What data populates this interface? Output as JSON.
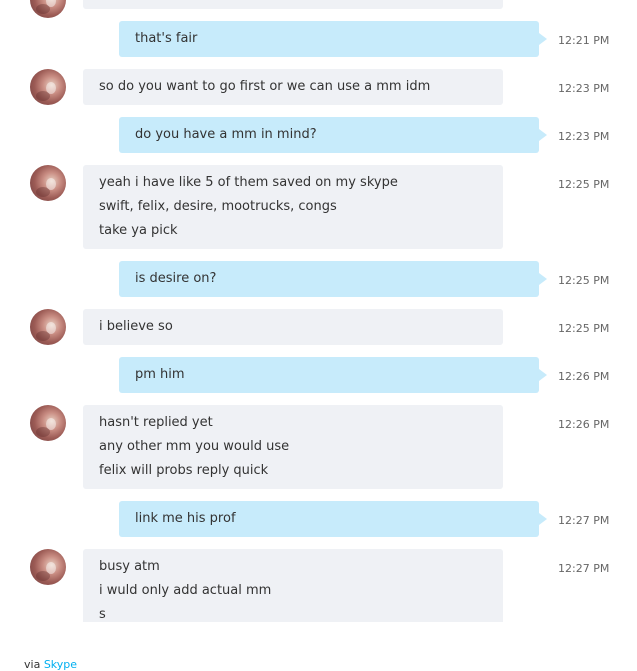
{
  "colors": {
    "incoming_bubble": "#eff1f5",
    "outgoing_bubble": "#c7ebfb",
    "link": "#00aff0",
    "timestamp": "#666666"
  },
  "messages": [
    {
      "direction": "incoming",
      "lines": [],
      "time": ""
    },
    {
      "direction": "outgoing",
      "lines": [
        "that's fair"
      ],
      "time": "12:21 PM"
    },
    {
      "direction": "incoming",
      "lines": [
        "so do you want to go first or we can use a mm idm"
      ],
      "time": "12:23 PM"
    },
    {
      "direction": "outgoing",
      "lines": [
        "do you have a mm in mind?"
      ],
      "time": "12:23 PM"
    },
    {
      "direction": "incoming",
      "lines": [
        "yeah i have like 5 of them saved on my skype",
        "swift, felix, desire, mootrucks, congs",
        "take ya pick"
      ],
      "time": "12:25 PM"
    },
    {
      "direction": "outgoing",
      "lines": [
        "is desire on?"
      ],
      "time": "12:25 PM"
    },
    {
      "direction": "incoming",
      "lines": [
        "i believe so"
      ],
      "time": "12:25 PM"
    },
    {
      "direction": "outgoing",
      "lines": [
        "pm him"
      ],
      "time": "12:26 PM"
    },
    {
      "direction": "incoming",
      "lines": [
        "hasn't replied yet",
        "any other mm you would use",
        "felix will probs reply quick"
      ],
      "time": "12:26 PM"
    },
    {
      "direction": "outgoing",
      "lines": [
        "link me his prof"
      ],
      "time": "12:27 PM"
    },
    {
      "direction": "incoming",
      "lines": [
        "busy atm",
        "i wuld only add actual mm",
        "s"
      ],
      "time": "12:27 PM"
    }
  ],
  "footer": {
    "prefix": "via ",
    "link_label": "Skype"
  }
}
